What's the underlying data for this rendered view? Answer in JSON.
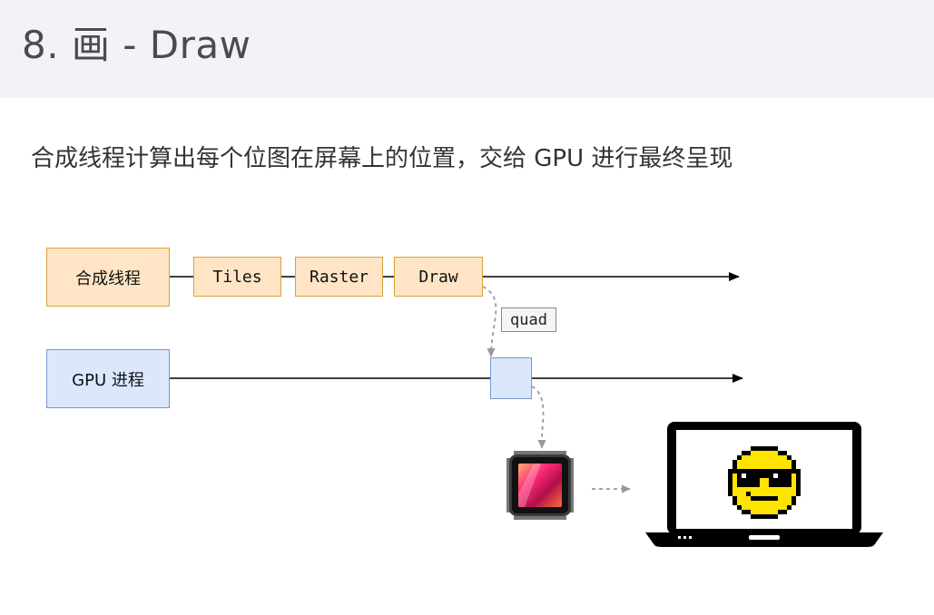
{
  "header": {
    "title": "8. 画 - Draw"
  },
  "subtitle": "合成线程计算出每个位图在屏幕上的位置，交给 GPU 进行最终呈现",
  "diagram": {
    "compositor_label": "合成线程",
    "tiles_label": "Tiles",
    "raster_label": "Raster",
    "draw_label": "Draw",
    "gpu_label": "GPU 进程",
    "quad_label": "quad"
  },
  "colors": {
    "orange_fill": "#ffe5c6",
    "orange_border": "#d8a23a",
    "blue_fill": "#dbe8fb",
    "blue_border": "#7a98cc",
    "emoji_yellow": "#ffe400"
  },
  "icons": [
    "gpu-chip-icon",
    "laptop-icon",
    "cool-smiley-icon"
  ]
}
